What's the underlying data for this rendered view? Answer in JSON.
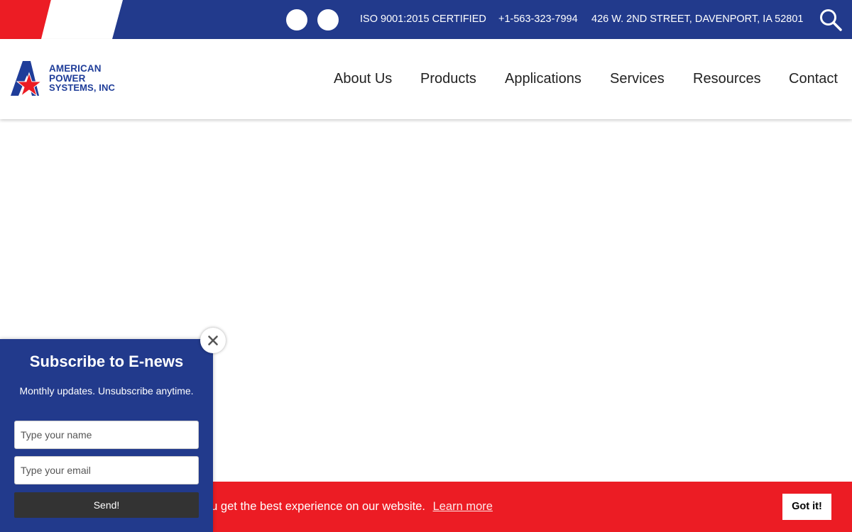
{
  "topbar": {
    "iso": "ISO 9001:2015 CERTIFIED",
    "phone": "+1-563-323-7994",
    "address": "426 W. 2ND STREET, DAVENPORT, IA 52801",
    "social_icons": [
      "social-icon-1",
      "social-icon-2"
    ],
    "search_icon": "search-icon"
  },
  "logo": {
    "line1": "AMERICAN",
    "line2": "POWER",
    "line3": "SYSTEMS, INC"
  },
  "nav": {
    "items": [
      {
        "label": "About Us"
      },
      {
        "label": "Products"
      },
      {
        "label": "Applications"
      },
      {
        "label": "Services"
      },
      {
        "label": "Resources"
      },
      {
        "label": "Contact"
      }
    ]
  },
  "popup": {
    "title": "Subscribe to E-news",
    "subtitle": "Monthly updates. Unsubscribe anytime.",
    "name_placeholder": "Type your name",
    "email_placeholder": "Type your email",
    "send_label": "Send!",
    "close_icon": "close-icon"
  },
  "cookie": {
    "message": "ou get the best experience on our website.",
    "link_label": "Learn more",
    "button_label": "Got it!"
  },
  "colors": {
    "brand_blue": "#223a8c",
    "brand_red": "#ec1c24",
    "logo_blue": "#1f3d99"
  }
}
